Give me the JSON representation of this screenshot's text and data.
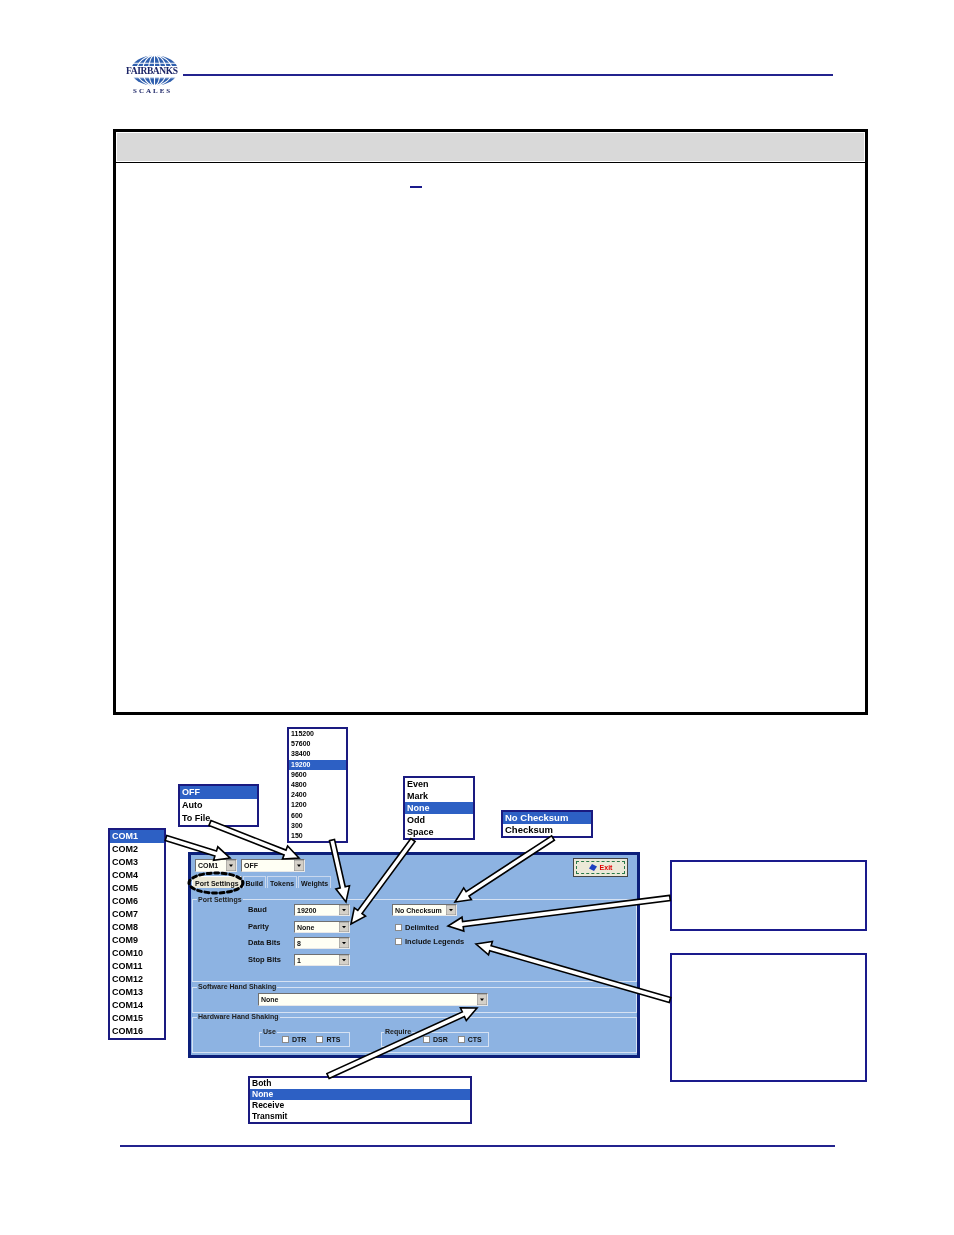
{
  "logo": {
    "wordmark": "FAIRBANKS",
    "tagline": "SCALES"
  },
  "port_settings_window": {
    "port": {
      "value": "COM1"
    },
    "output": {
      "value": "OFF"
    },
    "exit_button": {
      "label": "Exit"
    },
    "tabs": [
      {
        "label": "Port Settings",
        "selected": true
      },
      {
        "label": "Build",
        "selected": false
      },
      {
        "label": "Tokens",
        "selected": false
      },
      {
        "label": "Weights",
        "selected": false
      }
    ],
    "port_settings": {
      "title": "Port Settings",
      "fields": [
        {
          "label": "Baud",
          "value": "19200"
        },
        {
          "label": "Parity",
          "value": "None"
        },
        {
          "label": "Data Bits",
          "value": "8"
        },
        {
          "label": "Stop Bits",
          "value": "1"
        }
      ],
      "checksum": {
        "value": "No Checksum"
      },
      "options": [
        {
          "label": "Delimited",
          "checked": false
        },
        {
          "label": "Include Legends",
          "checked": false
        }
      ]
    },
    "software_hand_shaking": {
      "title": "Software Hand Shaking",
      "value": "None"
    },
    "hardware_hand_shaking": {
      "title": "Hardware Hand Shaking",
      "groups": [
        {
          "title": "Use",
          "options": [
            {
              "label": "DTR",
              "checked": false
            },
            {
              "label": "RTS",
              "checked": false
            }
          ]
        },
        {
          "title": "Require",
          "options": [
            {
              "label": "DSR",
              "checked": false
            },
            {
              "label": "CTS",
              "checked": false
            }
          ]
        }
      ]
    }
  },
  "callout_lists": [
    {
      "kind": "com",
      "items": [
        {
          "label": "COM1",
          "selected": true
        },
        {
          "label": "COM2",
          "selected": false
        },
        {
          "label": "COM3",
          "selected": false
        },
        {
          "label": "COM4",
          "selected": false
        },
        {
          "label": "COM5",
          "selected": false
        },
        {
          "label": "COM6",
          "selected": false
        },
        {
          "label": "COM7",
          "selected": false
        },
        {
          "label": "COM8",
          "selected": false
        },
        {
          "label": "COM9",
          "selected": false
        },
        {
          "label": "COM10",
          "selected": false
        },
        {
          "label": "COM11",
          "selected": false
        },
        {
          "label": "COM12",
          "selected": false
        },
        {
          "label": "COM13",
          "selected": false
        },
        {
          "label": "COM14",
          "selected": false
        },
        {
          "label": "COM15",
          "selected": false
        },
        {
          "label": "COM16",
          "selected": false
        }
      ]
    },
    {
      "kind": "output",
      "items": [
        {
          "label": "OFF",
          "selected": true
        },
        {
          "label": "Auto",
          "selected": false
        },
        {
          "label": "To File",
          "selected": false
        }
      ]
    },
    {
      "kind": "baud",
      "items": [
        {
          "label": "115200",
          "selected": false
        },
        {
          "label": "57600",
          "selected": false
        },
        {
          "label": "38400",
          "selected": false
        },
        {
          "label": "19200",
          "selected": true
        },
        {
          "label": "9600",
          "selected": false
        },
        {
          "label": "4800",
          "selected": false
        },
        {
          "label": "2400",
          "selected": false
        },
        {
          "label": "1200",
          "selected": false
        },
        {
          "label": "600",
          "selected": false
        },
        {
          "label": "300",
          "selected": false
        },
        {
          "label": "150",
          "selected": false
        }
      ]
    },
    {
      "kind": "parity",
      "items": [
        {
          "label": "Even",
          "selected": false
        },
        {
          "label": "Mark",
          "selected": false
        },
        {
          "label": "None",
          "selected": true
        },
        {
          "label": "Odd",
          "selected": false
        },
        {
          "label": "Space",
          "selected": false
        }
      ]
    },
    {
      "kind": "checksum",
      "items": [
        {
          "label": "No Checksum",
          "selected": true
        },
        {
          "label": "Checksum",
          "selected": false
        }
      ]
    },
    {
      "kind": "handshake",
      "items": [
        {
          "label": "Both",
          "selected": false
        },
        {
          "label": "None",
          "selected": true
        },
        {
          "label": "Receive",
          "selected": false
        },
        {
          "label": "Transmit",
          "selected": false
        }
      ]
    }
  ]
}
